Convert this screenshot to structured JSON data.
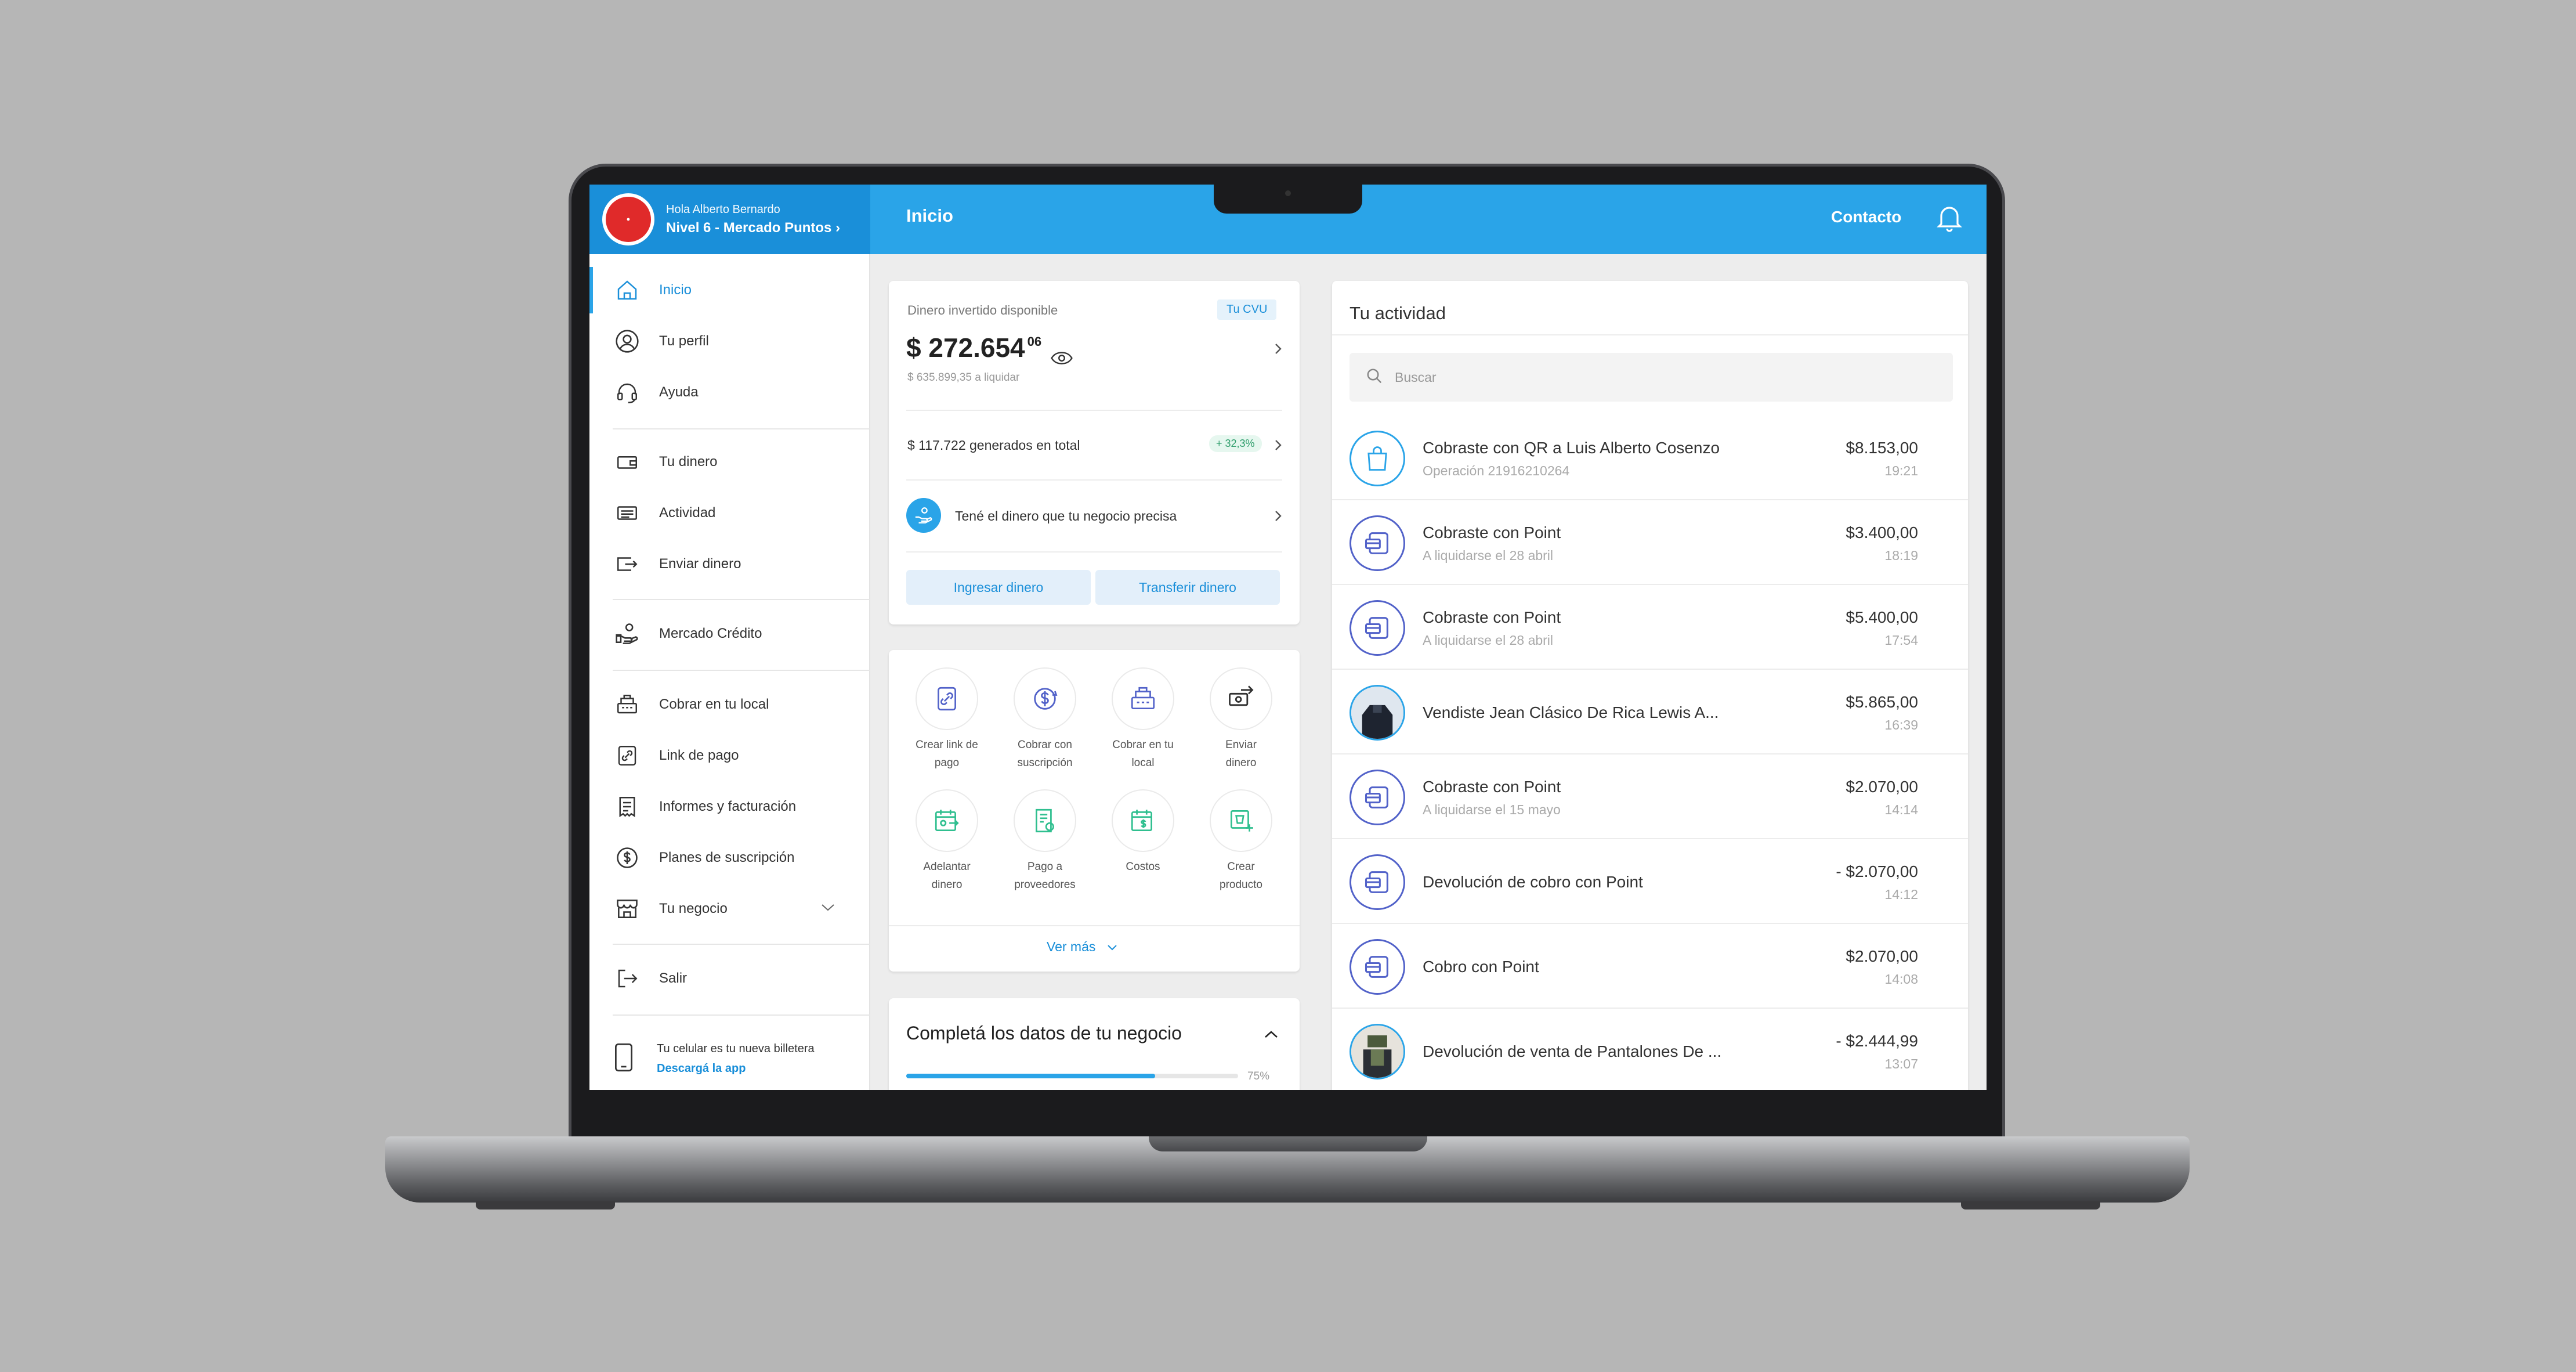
{
  "header": {
    "greeting": "Hola Alberto Bernardo",
    "level": "Nivel 6 - Mercado Puntos",
    "page_title": "Inicio",
    "contact": "Contacto"
  },
  "sidebar": {
    "items": [
      {
        "label": "Inicio",
        "icon": "home-icon"
      },
      {
        "label": "Tu perfil",
        "icon": "profile-icon"
      },
      {
        "label": "Ayuda",
        "icon": "headset-icon"
      },
      {
        "label": "Tu dinero",
        "icon": "wallet-icon"
      },
      {
        "label": "Actividad",
        "icon": "list-icon"
      },
      {
        "label": "Enviar dinero",
        "icon": "send-icon"
      },
      {
        "label": "Mercado Crédito",
        "icon": "credit-hand-icon"
      },
      {
        "label": "Cobrar en tu local",
        "icon": "register-icon"
      },
      {
        "label": "Link de pago",
        "icon": "link-icon"
      },
      {
        "label": "Informes y facturación",
        "icon": "receipt-icon"
      },
      {
        "label": "Planes de suscripción",
        "icon": "dollar-cycle-icon"
      },
      {
        "label": "Tu negocio",
        "icon": "store-icon"
      },
      {
        "label": "Salir",
        "icon": "logout-icon"
      }
    ],
    "promo_text": "Tu celular es tu nueva billetera",
    "promo_link": "Descargá la app"
  },
  "balance_card": {
    "label": "Dinero invertido disponible",
    "cvu_badge": "Tu CVU",
    "amount": "$ 272.654",
    "amount_cents": "06",
    "to_settle": "$ 635.899,35 a liquidar",
    "generated": "$ 117.722 generados en total",
    "generated_pct": "+ 32,3%",
    "promo": "Tené el dinero que tu negocio precisa",
    "deposit_button": "Ingresar dinero",
    "transfer_button": "Transferir dinero"
  },
  "quick_actions": {
    "items": [
      {
        "line1": "Crear link de",
        "line2": "pago"
      },
      {
        "line1": "Cobrar con",
        "line2": "suscripción"
      },
      {
        "line1": "Cobrar en tu",
        "line2": "local"
      },
      {
        "line1": "Enviar",
        "line2": "dinero"
      },
      {
        "line1": "Adelantar",
        "line2": "dinero"
      },
      {
        "line1": "Pago a",
        "line2": "proveedores"
      },
      {
        "line1": "Costos",
        "line2": ""
      },
      {
        "line1": "Crear",
        "line2": "producto"
      }
    ],
    "see_more": "Ver más"
  },
  "business_card": {
    "title": "Completá los datos de tu negocio",
    "progress_label": "75%",
    "progress_value": 0.75
  },
  "activity": {
    "title": "Tu actividad",
    "search_placeholder": "Buscar",
    "rows": [
      {
        "title": "Cobraste con QR a Luis Alberto Cosenzo",
        "sub": "Operación 21916210264",
        "amount": "$8.153,00",
        "time": "19:21",
        "kind": "qr"
      },
      {
        "title": "Cobraste con Point",
        "sub": "A liquidarse el 28 abril",
        "amount": "$3.400,00",
        "time": "18:19",
        "kind": "point"
      },
      {
        "title": "Cobraste con Point",
        "sub": "A liquidarse el 28 abril",
        "amount": "$5.400,00",
        "time": "17:54",
        "kind": "point"
      },
      {
        "title": "Vendiste Jean Clásico De Rica Lewis A...",
        "sub": "",
        "amount": "$5.865,00",
        "time": "16:39",
        "kind": "photo"
      },
      {
        "title": "Cobraste con Point",
        "sub": "A liquidarse el 15 mayo",
        "amount": "$2.070,00",
        "time": "14:14",
        "kind": "point"
      },
      {
        "title": "Devolución de cobro con Point",
        "sub": "",
        "amount": "- $2.070,00",
        "time": "14:12",
        "kind": "point"
      },
      {
        "title": "Cobro con Point",
        "sub": "",
        "amount": "$2.070,00",
        "time": "14:08",
        "kind": "point"
      },
      {
        "title": "Devolución de venta de Pantalones De ...",
        "sub": "",
        "amount": "- $2.444,99",
        "time": "13:07",
        "kind": "photo2"
      }
    ]
  },
  "colors": {
    "primary": "#2aa4e8",
    "header_dark": "#1a8fd9",
    "point_icon": "#5262c9",
    "positive": "#2e9d6b"
  }
}
